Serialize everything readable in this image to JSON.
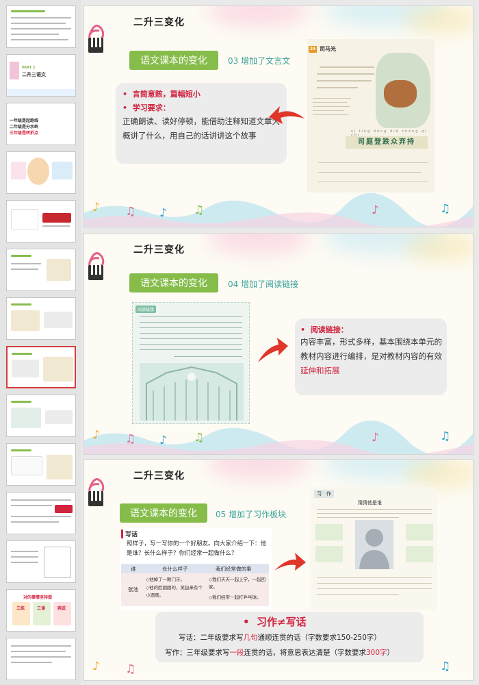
{
  "slide1": {
    "title": "二升三变化",
    "tag": "语文课本的变化",
    "subtitle": "03 增加了文言文",
    "bullet1": "言简意赅，篇幅短小",
    "bullet2": "学习要求：",
    "body": "正确朗读、读好停顿，能借助注释知道文章大概讲了什么，用自己的话讲讲这个故事",
    "lesson_num": "24",
    "lesson_title": "司马光",
    "idiom_pinyin": "sī  tíng  dēng  diē  zhòng  qì  chí",
    "idiom": "司庭登跌众弃持"
  },
  "slide2": {
    "title": "二升三变化",
    "tag": "语文课本的变化",
    "subtitle": "04 增加了阅读链接",
    "page_label": "阅读链接",
    "bullet": "阅读链接：",
    "body_pre": "内容丰富，形式多样，基本围绕本单元的教材内容进行编排，是对教材内容的有效",
    "body_hl": "延伸和拓展"
  },
  "slide3": {
    "title": "二升三变化",
    "tag": "语文课本的变化",
    "subtitle": "05 增加了习作板块",
    "xiehua_label": "写话",
    "xiehua_prompt": "照样子，写一写你的一个好朋友。向大家介绍一下：他是谁？长什么样子？你们经常一起做什么？",
    "table_headers": [
      "谁",
      "长什么样子",
      "我们经常做的事"
    ],
    "table_row_name": "张池",
    "table_col2": [
      "◇他掉了一颗门牙。",
      "◇他的脸圆圆的，笑起来有个小酒窝。"
    ],
    "table_col3": [
      "◇我们天天一起上学，一起回家。",
      "◇我们经常一起打乒乓球。"
    ],
    "xizuo_label": "习　作",
    "xizuo_title": "猜猜他是谁",
    "heading": "习作≠写话",
    "line1_pre": "写话：二年级要求写",
    "line1_hl": "几句",
    "line1_post": "通顺连贯的话（字数要求150-250字）",
    "line2_pre": "写作：三年级要求写",
    "line2_hl": "一段",
    "line2_mid": "连贯的话，将意思表达清楚（字数要求",
    "line2_hl2": "300字",
    "line2_post": "）"
  },
  "thumbnails": {
    "t1_title": "二升三语文",
    "t1_label": "PART 2",
    "t3_lines": [
      "一年级是起跑线",
      "二年级是分水岭",
      "三年级是转折点"
    ],
    "t13_title": "对的事情坚持做",
    "t13_cols": [
      "三练",
      "三读",
      "两说"
    ]
  },
  "colors": {
    "accent_green": "#86bd4a",
    "teal": "#3aa39a",
    "red": "#d2233f",
    "active_border": "#d43c3c"
  }
}
